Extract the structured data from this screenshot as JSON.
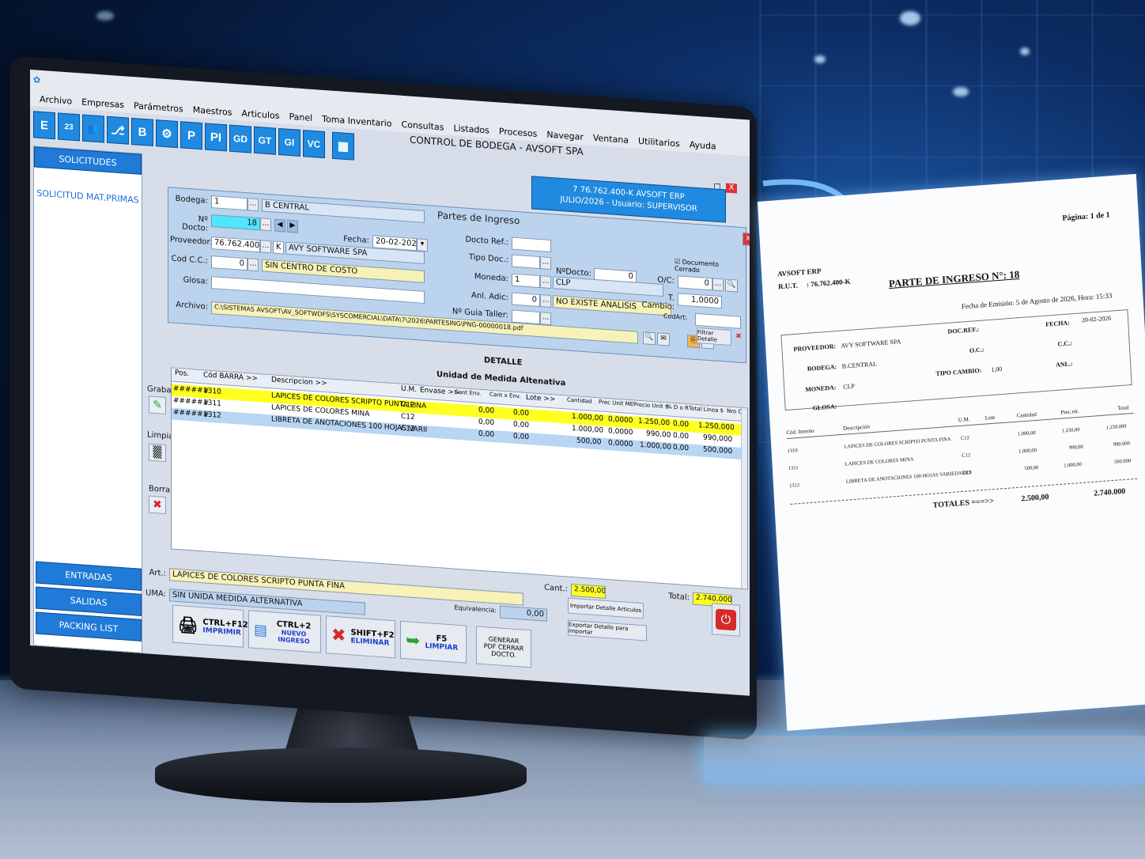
{
  "app": {
    "title": "CONTROL DE BODEGA - AVSOFT SPA",
    "menu": [
      "Archivo",
      "Empresas",
      "Parámetros",
      "Maestros",
      "Articulos",
      "Panel",
      "Toma Inventario",
      "Consultas",
      "Listados",
      "Procesos",
      "Navegar",
      "Ventana",
      "Utilitarios",
      "Ayuda"
    ],
    "window_controls": [
      "_",
      "□",
      "X"
    ]
  },
  "toolbar": {
    "buttons": [
      "E",
      "23",
      "👥",
      "⎇",
      "B",
      "⚙",
      "P",
      "PI",
      "GD",
      "GT",
      "GI",
      "VC",
      "▦"
    ]
  },
  "sidebar": {
    "header": "SOLICITUDES",
    "link": "SOLICITUD MAT.PRIMAS",
    "bottom_buttons": [
      "ENTRADAS",
      "SALIDAS",
      "PACKING LIST"
    ]
  },
  "info": {
    "line1": "7  76.762.400-K  AVSOFT ERP",
    "line2": "JULIO/2026  -  Usuario: SUPERVISOR"
  },
  "form": {
    "title": "Partes de Ingreso",
    "bodega_label": "Bodega:",
    "bodega_code": "1",
    "bodega_name": "B CENTRAL",
    "ndocto_label": "Nº Docto:",
    "ndocto_value": "18",
    "fecha_label": "Fecha:",
    "fecha_value": "20-02-2026",
    "proveedor_label": "Proveedor:",
    "proveedor_rut": "76.762.400",
    "proveedor_dv": "K",
    "proveedor_name": "AVY SOFTWARE SPA",
    "codcc_label": "Cod C.C.:",
    "codcc_value": "0",
    "codcc_name": "SIN CENTRO DE COSTO",
    "glosa_label": "Glosa:",
    "glosa_value": "",
    "archivo_label": "Archivo:",
    "archivo_value": "C:\\SISTEMAS AVSOFT\\AV_SOFTWDFS\\SYSCOMERCIAL\\DATA\\7\\2026\\PARTESING\\PNG-00000018.pdf",
    "docto_ref_label": "Docto Ref.:",
    "tipo_doc_label": "Tipo Doc.:",
    "ndocto2_label": "NºDocto:",
    "ndocto2_value": "0",
    "moneda_label": "Moneda:",
    "moneda_code": "1",
    "moneda_name": "CLP",
    "anl_label": "Anl. Adic:",
    "anl_value": "0",
    "anl_name": "NO EXISTE ANALISIS",
    "guia_label": "Nº Guia Taller:",
    "oc_label": "O/C:",
    "oc_value": "0",
    "tcambio_label": "T. Cambio:",
    "tcambio_value": "1,0000",
    "doc_cerrado": "Documento Cerrado",
    "codart_label": "CodArt:",
    "filtrar": "Filtrar Detalle"
  },
  "detalle": {
    "title": "DETALLE",
    "subtitle": "Unidad de Medida Altenativa",
    "columns": [
      "Pos.",
      "Cód BARRA >>",
      "Descripcion >>",
      "U.M.",
      "Envase >>",
      "Cant Env.",
      "Cant x Env.",
      "Lote >>",
      "Cantidad",
      "Prec Unit ME",
      "Precio Unit $",
      "% D o R",
      "Total Linea $",
      "Nro OC"
    ],
    "rows": [
      {
        "pos": "######",
        "cod": "1310",
        "desc": "LAPICES DE COLORES SCRIPTO PUNTA FINA",
        "um": "C12",
        "cantenv": "0,00",
        "cantxenv": "0,00",
        "cantidad": "1.000,00",
        "precme": "0,0000",
        "precunit": "1.250,00",
        "dr": "0,00",
        "total": "1.250,000"
      },
      {
        "pos": "######",
        "cod": "1311",
        "desc": "LAPICES DE COLORES MINA",
        "um": "C12",
        "cantenv": "0,00",
        "cantxenv": "0,00",
        "cantidad": "1.000,00",
        "precme": "0,0000",
        "precunit": "990,00",
        "dr": "0,00",
        "total": "990,000"
      },
      {
        "pos": "######",
        "cod": "1312",
        "desc": "LIBRETA DE ANOTACIONES 100 HOJAS VARII",
        "um": "C12",
        "cantenv": "0,00",
        "cantxenv": "0,00",
        "cantidad": "500,00",
        "precme": "0,0000",
        "precunit": "1.000,00",
        "dr": "0,00",
        "total": "500,000"
      }
    ],
    "side_actions": [
      "Grabar",
      "Limpiar",
      "Borrar"
    ]
  },
  "bottom": {
    "cant_label": "Cant.:",
    "cant_value": "2.500,00",
    "total_label": "Total:",
    "total_value": "2.740,000",
    "art_label": "Art.:",
    "art_value": "LAPICES DE COLORES SCRIPTO PUNTA FINA",
    "uma_label": "UMA:",
    "uma_value": "SIN UNIDA MEDIDA ALTERNATIVA",
    "equiv_label": "Equivalencia:",
    "equiv_value": "0,00",
    "importar": "Importar Detalle Articulos",
    "exportar": "Exportar Detalle para importar",
    "btn_print_key": "CTRL+F12",
    "btn_print": "IMPRIMIR",
    "btn_new_key": "CTRL+2",
    "btn_new": "NUEVO INGRESO",
    "btn_del_key": "SHIFT+F2",
    "btn_del": "ELIMINAR",
    "btn_clear_key": "F5",
    "btn_clear": "LIMPIAR",
    "btn_pdf": "GENERAR PDF CERRAR DOCTO."
  },
  "paper": {
    "pagina": "Página: 1 de 1",
    "company": "AVSOFT ERP",
    "rut_label": "R.U.T.",
    "rut": ": 76.762.400-K",
    "title": "PARTE DE INGRESO N°: 18",
    "emision": "Fecha de Emisión: 5 de Agosto de 2026, Hora: 15:33",
    "proveedor_label": "PROVEEDOR:",
    "proveedor": "AVY SOFTWARE SPA",
    "bodega_label": "BODEGA:",
    "bodega": "B.CENTRAL",
    "moneda_label": "MONEDA:",
    "moneda": "CLP",
    "glosa_label": "GLOSA:",
    "docref_label": "DOC.REF.:",
    "oc_label": "O.C.:",
    "tipocambio_label": "TIPO CAMBIO:",
    "tipocambio": "1,00",
    "fecha_label": "FECHA:",
    "fecha": "20-02-2026",
    "cc_label": "C.C.:",
    "anl_label": "ANL.:",
    "columns": [
      "Cód. Interno",
      "Descripción",
      "U.M.",
      "Lote",
      "Cantidad",
      "Prec.nit.",
      "Total"
    ],
    "rows": [
      {
        "cod": "1310",
        "desc": "LAPICES DE COLORES SCRIPTO PUNTA FINA",
        "um": "C12",
        "cant": "1.000,00",
        "prec": "1.250,00",
        "total": "1.250.000"
      },
      {
        "cod": "1311",
        "desc": "LAPICES DE COLORES MINA",
        "um": "C12",
        "cant": "1.000,00",
        "prec": "990,00",
        "total": "990.000"
      },
      {
        "cod": "1312",
        "desc": "LIBRETA DE ANOTACIONES 100 HOJAS VARIEDADES",
        "um": "C12",
        "cant": "500,00",
        "prec": "1.000,00",
        "total": "500.000"
      }
    ],
    "totales_label": "TOTALES ===>>",
    "totales_cant": "2.500,00",
    "totales_total": "2.740.000"
  }
}
